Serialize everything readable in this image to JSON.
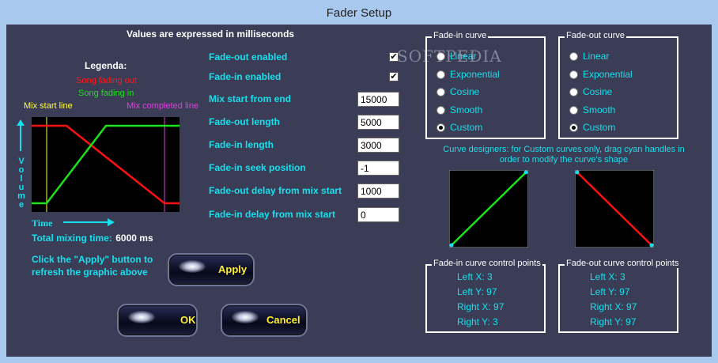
{
  "window": {
    "title": "Fader Setup"
  },
  "header": {
    "note": "Values are expressed in milliseconds"
  },
  "legend": {
    "title": "Legenda:",
    "song_fading_out": "Song fading out",
    "song_fading_in": "Song fading in",
    "mix_start_line": "Mix start line",
    "mix_completed_line": "Mix completed line"
  },
  "graph": {
    "volume_label": [
      "V",
      "o",
      "l",
      "u",
      "m",
      "e"
    ],
    "time_label": "Time",
    "total_label": "Total mixing time:",
    "total_value": "6000 ms"
  },
  "settings": {
    "fade_out_enabled": {
      "label": "Fade-out enabled",
      "checked": "✔"
    },
    "fade_in_enabled": {
      "label": "Fade-in enabled",
      "checked": "✔"
    },
    "mix_start_from_end": {
      "label": "Mix start from end",
      "value": "15000"
    },
    "fade_out_length": {
      "label": "Fade-out length",
      "value": "5000"
    },
    "fade_in_length": {
      "label": "Fade-in length",
      "value": "3000"
    },
    "fade_in_seek_position": {
      "label": "Fade-in seek position",
      "value": "-1"
    },
    "fade_out_delay": {
      "label": "Fade-out delay from mix start",
      "value": "1000"
    },
    "fade_in_delay": {
      "label": "Fade-in delay from mix start",
      "value": "0"
    }
  },
  "apply_hint": "Click the \"Apply\" button to refresh the graphic above",
  "buttons": {
    "apply": "Apply",
    "ok": "OK",
    "cancel": "Cancel"
  },
  "fade_in_curve": {
    "title": "Fade-in curve",
    "options": [
      "Linear",
      "Exponential",
      "Cosine",
      "Smooth",
      "Custom"
    ],
    "selected": "Custom"
  },
  "fade_out_curve": {
    "title": "Fade-out curve",
    "options": [
      "Linear",
      "Exponential",
      "Cosine",
      "Smooth",
      "Custom"
    ],
    "selected": "Custom"
  },
  "curve_designers": {
    "note": "Curve designers: for Custom curves only, drag cyan handles in order to modify the curve's shape"
  },
  "fade_in_cp": {
    "title": "Fade-in curve control points",
    "left_x": "Left X: 3",
    "left_y": "Left Y: 97",
    "right_x": "Right X: 97",
    "right_y": "Right Y: 3"
  },
  "fade_out_cp": {
    "title": "Fade-out curve control points",
    "left_x": "Left X: 3",
    "left_y": "Left Y: 97",
    "right_x": "Right X: 97",
    "right_y": "Right Y: 97"
  },
  "watermark": "SOFTPEDIA",
  "colors": {
    "cyan": "#16e0ee",
    "fade_out_red": "#ff1010",
    "fade_in_green": "#19e319",
    "mix_start_yellow": "#ffff40",
    "mix_complete_magenta": "#e040e0",
    "button_text": "#ffee2a"
  }
}
